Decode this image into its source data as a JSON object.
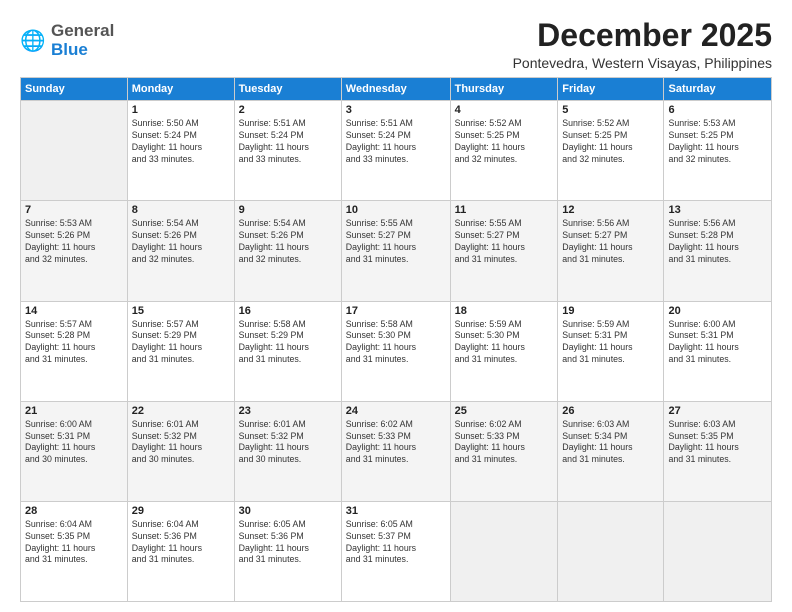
{
  "header": {
    "logo_general": "General",
    "logo_blue": "Blue",
    "main_title": "December 2025",
    "subtitle": "Pontevedra, Western Visayas, Philippines"
  },
  "days_of_week": [
    "Sunday",
    "Monday",
    "Tuesday",
    "Wednesday",
    "Thursday",
    "Friday",
    "Saturday"
  ],
  "weeks": [
    [
      {
        "day": "",
        "info": ""
      },
      {
        "day": "1",
        "info": "Sunrise: 5:50 AM\nSunset: 5:24 PM\nDaylight: 11 hours\nand 33 minutes."
      },
      {
        "day": "2",
        "info": "Sunrise: 5:51 AM\nSunset: 5:24 PM\nDaylight: 11 hours\nand 33 minutes."
      },
      {
        "day": "3",
        "info": "Sunrise: 5:51 AM\nSunset: 5:24 PM\nDaylight: 11 hours\nand 33 minutes."
      },
      {
        "day": "4",
        "info": "Sunrise: 5:52 AM\nSunset: 5:25 PM\nDaylight: 11 hours\nand 32 minutes."
      },
      {
        "day": "5",
        "info": "Sunrise: 5:52 AM\nSunset: 5:25 PM\nDaylight: 11 hours\nand 32 minutes."
      },
      {
        "day": "6",
        "info": "Sunrise: 5:53 AM\nSunset: 5:25 PM\nDaylight: 11 hours\nand 32 minutes."
      }
    ],
    [
      {
        "day": "7",
        "info": "Sunrise: 5:53 AM\nSunset: 5:26 PM\nDaylight: 11 hours\nand 32 minutes."
      },
      {
        "day": "8",
        "info": "Sunrise: 5:54 AM\nSunset: 5:26 PM\nDaylight: 11 hours\nand 32 minutes."
      },
      {
        "day": "9",
        "info": "Sunrise: 5:54 AM\nSunset: 5:26 PM\nDaylight: 11 hours\nand 32 minutes."
      },
      {
        "day": "10",
        "info": "Sunrise: 5:55 AM\nSunset: 5:27 PM\nDaylight: 11 hours\nand 31 minutes."
      },
      {
        "day": "11",
        "info": "Sunrise: 5:55 AM\nSunset: 5:27 PM\nDaylight: 11 hours\nand 31 minutes."
      },
      {
        "day": "12",
        "info": "Sunrise: 5:56 AM\nSunset: 5:27 PM\nDaylight: 11 hours\nand 31 minutes."
      },
      {
        "day": "13",
        "info": "Sunrise: 5:56 AM\nSunset: 5:28 PM\nDaylight: 11 hours\nand 31 minutes."
      }
    ],
    [
      {
        "day": "14",
        "info": "Sunrise: 5:57 AM\nSunset: 5:28 PM\nDaylight: 11 hours\nand 31 minutes."
      },
      {
        "day": "15",
        "info": "Sunrise: 5:57 AM\nSunset: 5:29 PM\nDaylight: 11 hours\nand 31 minutes."
      },
      {
        "day": "16",
        "info": "Sunrise: 5:58 AM\nSunset: 5:29 PM\nDaylight: 11 hours\nand 31 minutes."
      },
      {
        "day": "17",
        "info": "Sunrise: 5:58 AM\nSunset: 5:30 PM\nDaylight: 11 hours\nand 31 minutes."
      },
      {
        "day": "18",
        "info": "Sunrise: 5:59 AM\nSunset: 5:30 PM\nDaylight: 11 hours\nand 31 minutes."
      },
      {
        "day": "19",
        "info": "Sunrise: 5:59 AM\nSunset: 5:31 PM\nDaylight: 11 hours\nand 31 minutes."
      },
      {
        "day": "20",
        "info": "Sunrise: 6:00 AM\nSunset: 5:31 PM\nDaylight: 11 hours\nand 31 minutes."
      }
    ],
    [
      {
        "day": "21",
        "info": "Sunrise: 6:00 AM\nSunset: 5:31 PM\nDaylight: 11 hours\nand 30 minutes."
      },
      {
        "day": "22",
        "info": "Sunrise: 6:01 AM\nSunset: 5:32 PM\nDaylight: 11 hours\nand 30 minutes."
      },
      {
        "day": "23",
        "info": "Sunrise: 6:01 AM\nSunset: 5:32 PM\nDaylight: 11 hours\nand 30 minutes."
      },
      {
        "day": "24",
        "info": "Sunrise: 6:02 AM\nSunset: 5:33 PM\nDaylight: 11 hours\nand 31 minutes."
      },
      {
        "day": "25",
        "info": "Sunrise: 6:02 AM\nSunset: 5:33 PM\nDaylight: 11 hours\nand 31 minutes."
      },
      {
        "day": "26",
        "info": "Sunrise: 6:03 AM\nSunset: 5:34 PM\nDaylight: 11 hours\nand 31 minutes."
      },
      {
        "day": "27",
        "info": "Sunrise: 6:03 AM\nSunset: 5:35 PM\nDaylight: 11 hours\nand 31 minutes."
      }
    ],
    [
      {
        "day": "28",
        "info": "Sunrise: 6:04 AM\nSunset: 5:35 PM\nDaylight: 11 hours\nand 31 minutes."
      },
      {
        "day": "29",
        "info": "Sunrise: 6:04 AM\nSunset: 5:36 PM\nDaylight: 11 hours\nand 31 minutes."
      },
      {
        "day": "30",
        "info": "Sunrise: 6:05 AM\nSunset: 5:36 PM\nDaylight: 11 hours\nand 31 minutes."
      },
      {
        "day": "31",
        "info": "Sunrise: 6:05 AM\nSunset: 5:37 PM\nDaylight: 11 hours\nand 31 minutes."
      },
      {
        "day": "",
        "info": ""
      },
      {
        "day": "",
        "info": ""
      },
      {
        "day": "",
        "info": ""
      }
    ]
  ]
}
